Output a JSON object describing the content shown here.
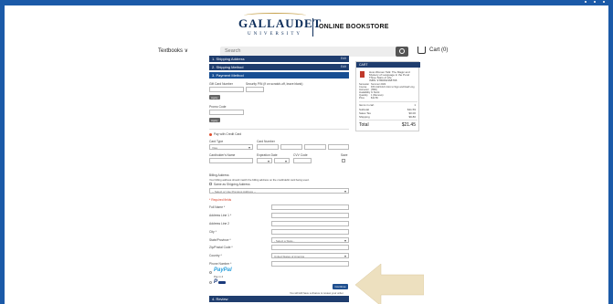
{
  "header": {
    "logo_main": "GALLAUDET",
    "logo_sub": "UNIVERSITY",
    "store_name": "ONLINE BOOKSTORE"
  },
  "nav": {
    "textbooks_label": "Textbooks ∨",
    "search_placeholder": "Search",
    "cart_label": "Cart (0)"
  },
  "checkout": {
    "steps": [
      {
        "label": "1. Shipping Address",
        "edit": "Edit"
      },
      {
        "label": "2. Shipping Method",
        "edit": "Edit"
      },
      {
        "label": "3. Payment Method"
      },
      {
        "label": "4. Review"
      }
    ],
    "gift_card_label": "Gift Card Number",
    "gift_pin_label": "Security PIN (if on scratch-off, leave blank)",
    "apply_label": "Apply",
    "promo_label": "Promo Code",
    "pay_cc_label": "Pay with Credit Card",
    "card_type_label": "Card Type",
    "card_type_value": "Visa",
    "card_number_label": "Card Number",
    "cardholder_label": "Cardholder's Name",
    "expiration_label": "Expiration Date",
    "cvv_label": "CVV Code",
    "save_label": "Save",
    "billing_label": "Billing Address",
    "billing_note": "Your billing address should match the billing address on the credit/debit card being used.",
    "same_as_shipping": "Same as Shipping Address",
    "prev_address_select": "-- Select or Use Previous Address --",
    "required_note": "* Required fields",
    "fields": [
      "Full Name *",
      "Address Line 1 *",
      "Address Line 2",
      "City *",
      "State/Province *",
      "Zip/Postal Code *",
      "Country *",
      "Phone Number *"
    ],
    "state_select": "- Select a State -",
    "country_select": "United States of America",
    "paypal_label": "PayPal",
    "paypal_sub": "Pay in 4",
    "continue_label": "Continue",
    "review_note": "You will still have a chance to review your order."
  },
  "cart": {
    "title": "CART",
    "item_lines": [
      "How Women Talk: The Magic and",
      "Mystery of Language in the Pond",
      "Three Stars of Life",
      "ISBN: 9780062368768"
    ],
    "meta_labels": [
      "Semester",
      "Course",
      "Instructor",
      "Availability",
      "Quantity",
      "Price"
    ],
    "meta_values": [
      "Summer 2024",
      "DIS 4123-021 Intro to Sign and Deaf Ling",
      "[TBD]",
      "In Stock",
      "1 (Remove)",
      "$11.59"
    ],
    "subtotal_label": "Subtotal",
    "subtotal": "$11.59",
    "sales_tax_label": "Sales Tax",
    "sales_tax": "$0.00",
    "shipping_label": "Shipping",
    "shipping": "$9.86",
    "total_label": "Total",
    "total": "$21.45",
    "items_label": "Items in cart",
    "items_count": "1"
  },
  "colors": {
    "border": "#1b5aa8",
    "step_bar": "#1f3d6e",
    "arrow": "#ede0bf",
    "gold": "#c6a14b"
  }
}
